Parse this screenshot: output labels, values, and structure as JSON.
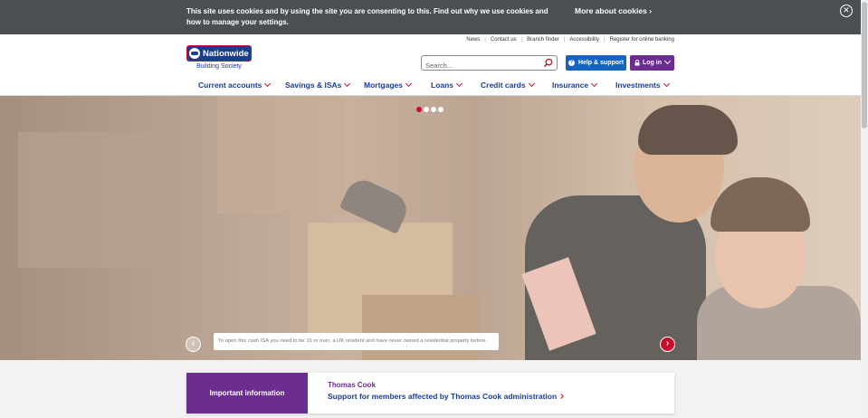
{
  "cookie_bar": {
    "text": "This site uses cookies and by using the site you are consenting to this. Find out why we use cookies and how to manage your settings.",
    "more_label": "More about cookies",
    "close_icon": "close-circle-icon"
  },
  "brand": {
    "name": "Nationwide",
    "sub": "Building Society",
    "colors": {
      "navy": "#1a3d8f",
      "red": "#c8102e",
      "purple": "#6b2d90",
      "blue": "#1565c0"
    }
  },
  "util_links": [
    "News",
    "Contact us",
    "Branch finder",
    "Accessibility",
    "Register for online banking"
  ],
  "search": {
    "placeholder": "Search..."
  },
  "help_button": {
    "label": "Help & support"
  },
  "login_button": {
    "label": "Log in"
  },
  "nav": [
    {
      "label": "Current accounts"
    },
    {
      "label": "Savings & ISAs"
    },
    {
      "label": "Mortgages"
    },
    {
      "label": "Loans"
    },
    {
      "label": "Credit cards"
    },
    {
      "label": "Insurance"
    },
    {
      "label": "Investments"
    }
  ],
  "hero": {
    "slide_count": 4,
    "active_slide": 1,
    "disclaimer": "To open this cash ISA you need to be 16 or over, a UK resident and have never owned a residential property before."
  },
  "important_info": {
    "label": "Important information",
    "title": "Thomas Cook",
    "link": "Support for members affected by Thomas Cook administration"
  }
}
